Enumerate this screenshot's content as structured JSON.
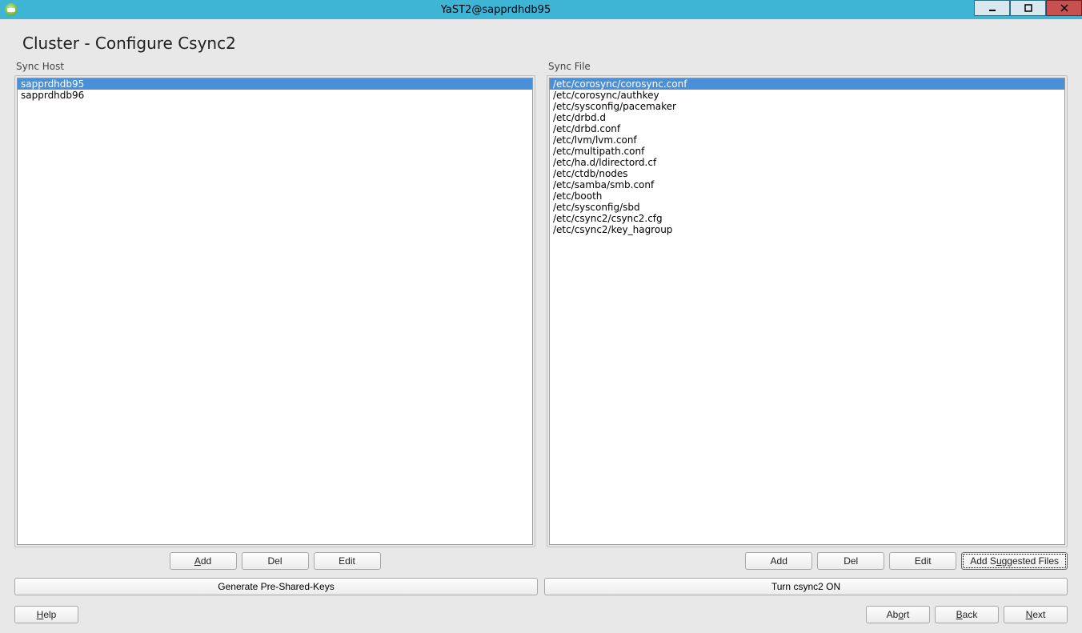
{
  "window": {
    "title": "YaST2@sapprdhdb95"
  },
  "page": {
    "title": "Cluster - Configure Csync2"
  },
  "sync_host": {
    "label": "Sync Host",
    "items": [
      "sapprdhdb95",
      "sapprdhdb96"
    ],
    "selected_index": 0,
    "buttons": {
      "add": "Add",
      "del": "Del",
      "edit": "Edit"
    }
  },
  "sync_file": {
    "label": "Sync File",
    "items": [
      "/etc/corosync/corosync.conf",
      "/etc/corosync/authkey",
      "/etc/sysconfig/pacemaker",
      "/etc/drbd.d",
      "/etc/drbd.conf",
      "/etc/lvm/lvm.conf",
      "/etc/multipath.conf",
      "/etc/ha.d/ldirectord.cf",
      "/etc/ctdb/nodes",
      "/etc/samba/smb.conf",
      "/etc/booth",
      "/etc/sysconfig/sbd",
      "/etc/csync2/csync2.cfg",
      "/etc/csync2/key_hagroup"
    ],
    "selected_index": 0,
    "buttons": {
      "add": "Add",
      "del": "Del",
      "edit": "Edit",
      "suggested": "Add Suggested Files"
    }
  },
  "wide": {
    "generate_keys": "Generate Pre-Shared-Keys",
    "turn_on": "Turn csync2 ON"
  },
  "nav": {
    "help": "Help",
    "abort": "Abort",
    "back": "Back",
    "next": "Next"
  }
}
